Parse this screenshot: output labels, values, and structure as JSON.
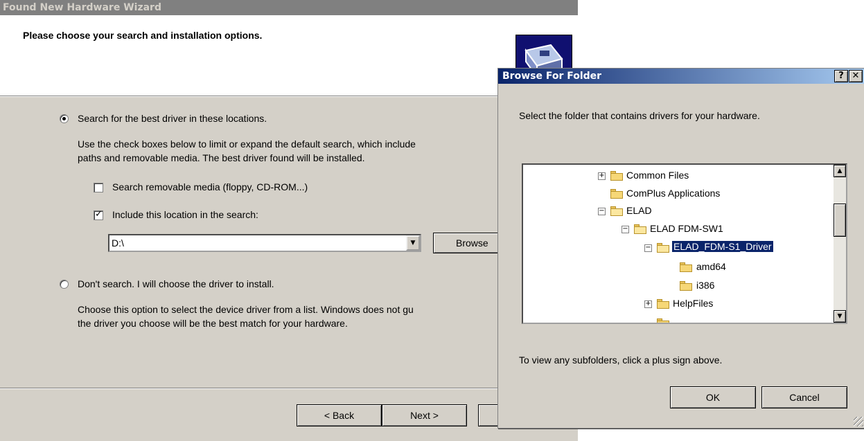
{
  "wizard": {
    "title": "Found New Hardware Wizard",
    "heading": "Please choose your search and installation options.",
    "option_search": "Search for the best driver in these locations.",
    "option_search_desc1": "Use the check boxes below to limit or expand the default search, which include",
    "option_search_desc2": "paths and removable media. The best driver found will be installed.",
    "checkbox_removable": "Search removable media (floppy, CD-ROM...)",
    "checkbox_location": "Include this location in the search:",
    "location_value": "D:\\",
    "browse_button": "Browse",
    "option_dont_search": "Don't search. I will choose the driver to install.",
    "option_dont_desc1": "Choose this option to select the device driver from a list.  Windows does not gu",
    "option_dont_desc2": "the driver you choose will be the best match for your hardware.",
    "back_button": "< Back",
    "next_button": "Next >"
  },
  "browse_dialog": {
    "title": "Browse For Folder",
    "help_button": "?",
    "close_button": "✕",
    "instruction": "Select the folder that contains drivers for your hardware.",
    "tree": [
      {
        "label": "Common Files",
        "expander": "+"
      },
      {
        "label": "ComPlus Applications",
        "expander": ""
      },
      {
        "label": "ELAD",
        "expander": "−"
      },
      {
        "label": "ELAD FDM-SW1",
        "expander": "−"
      },
      {
        "label": "ELAD_FDM-S1_Driver",
        "expander": "−"
      },
      {
        "label": "amd64",
        "expander": ""
      },
      {
        "label": "i386",
        "expander": ""
      },
      {
        "label": "HelpFiles",
        "expander": "+"
      }
    ],
    "hint": "To view any subfolders, click a plus sign above.",
    "ok_button": "OK",
    "cancel_button": "Cancel"
  }
}
